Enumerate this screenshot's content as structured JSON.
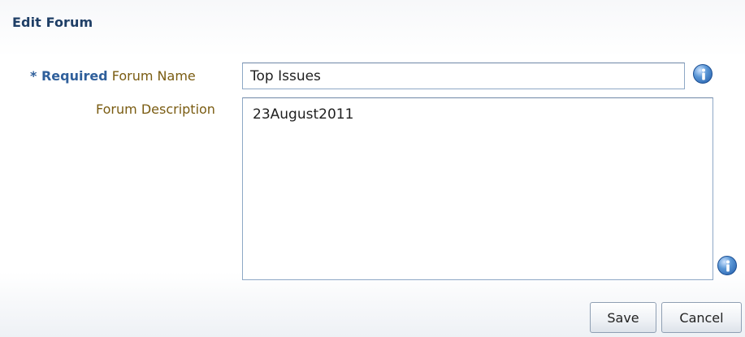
{
  "dialog": {
    "title": "Edit Forum"
  },
  "form": {
    "required_marker": "* Required",
    "forum_name": {
      "label": "Forum Name",
      "value": "Top Issues"
    },
    "forum_description": {
      "label": "Forum Description",
      "value": "23August2011"
    }
  },
  "buttons": {
    "save_label": "Save",
    "cancel_label": "Cancel"
  },
  "icons": {
    "forum_name_info": "info-icon",
    "forum_description_info": "info-icon"
  },
  "colors": {
    "title": "#1f3f66",
    "required_marker": "#2f5f9b",
    "label": "#7a5c12",
    "input_border": "#8ea8c6",
    "info_icon": "#1f5aa8"
  }
}
